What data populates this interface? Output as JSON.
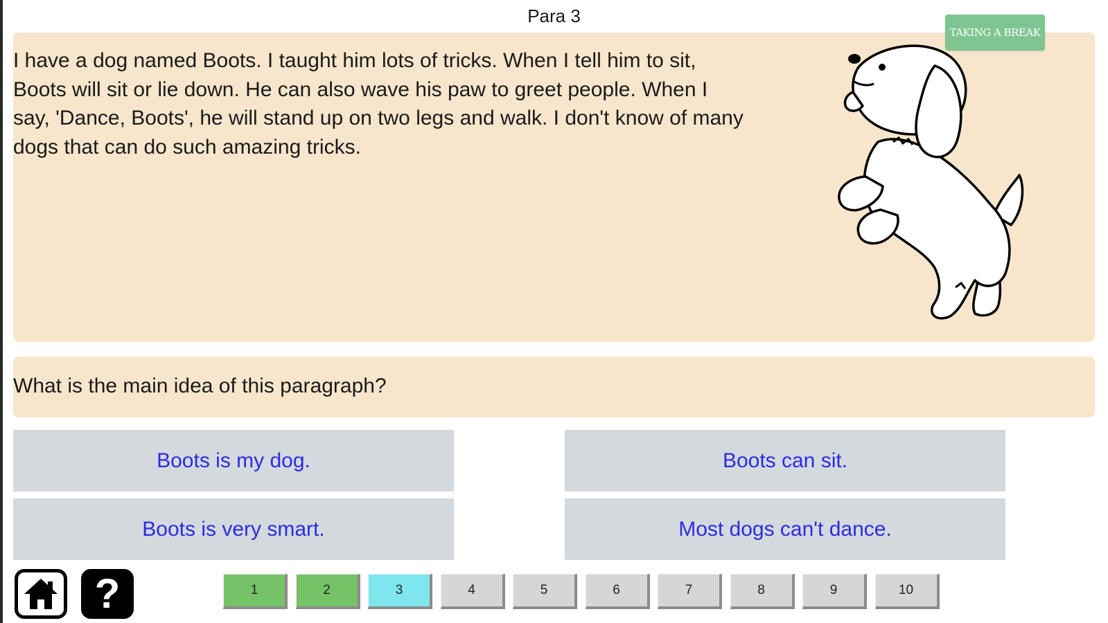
{
  "header": {
    "title": "Para 3",
    "break_button_label": "TAKING A BREAK"
  },
  "passage": {
    "text": "I have a dog named Boots. I taught him lots of tricks. When I tell him to sit, Boots will sit or lie down. He can also wave his paw to greet people. When I say, 'Dance, Boots', he will stand up on two legs and walk. I don't know of many dogs that can do such amazing tricks.",
    "image_icon": "dog-illustration"
  },
  "question": {
    "text": "What is the main idea of this paragraph?"
  },
  "answers": [
    "Boots is my dog.",
    "Boots can sit.",
    "Boots is very smart.",
    "Most dogs can't dance."
  ],
  "footer": {
    "home_icon": "home-icon",
    "help_icon": "question-mark-icon",
    "help_glyph": "?"
  },
  "pages": [
    {
      "label": "1",
      "state": "done"
    },
    {
      "label": "2",
      "state": "done"
    },
    {
      "label": "3",
      "state": "current"
    },
    {
      "label": "4",
      "state": "pending"
    },
    {
      "label": "5",
      "state": "pending"
    },
    {
      "label": "6",
      "state": "pending"
    },
    {
      "label": "7",
      "state": "pending"
    },
    {
      "label": "8",
      "state": "pending"
    },
    {
      "label": "9",
      "state": "pending"
    },
    {
      "label": "10",
      "state": "pending"
    }
  ],
  "colors": {
    "panel": "#f7e6cc",
    "answer_bg": "#d3d9dd",
    "answer_text": "#2b2be3",
    "page_done": "#75c367",
    "page_current": "#7ee6ec",
    "page_pending": "#d6d6d6",
    "break_button": "#7fc591"
  }
}
